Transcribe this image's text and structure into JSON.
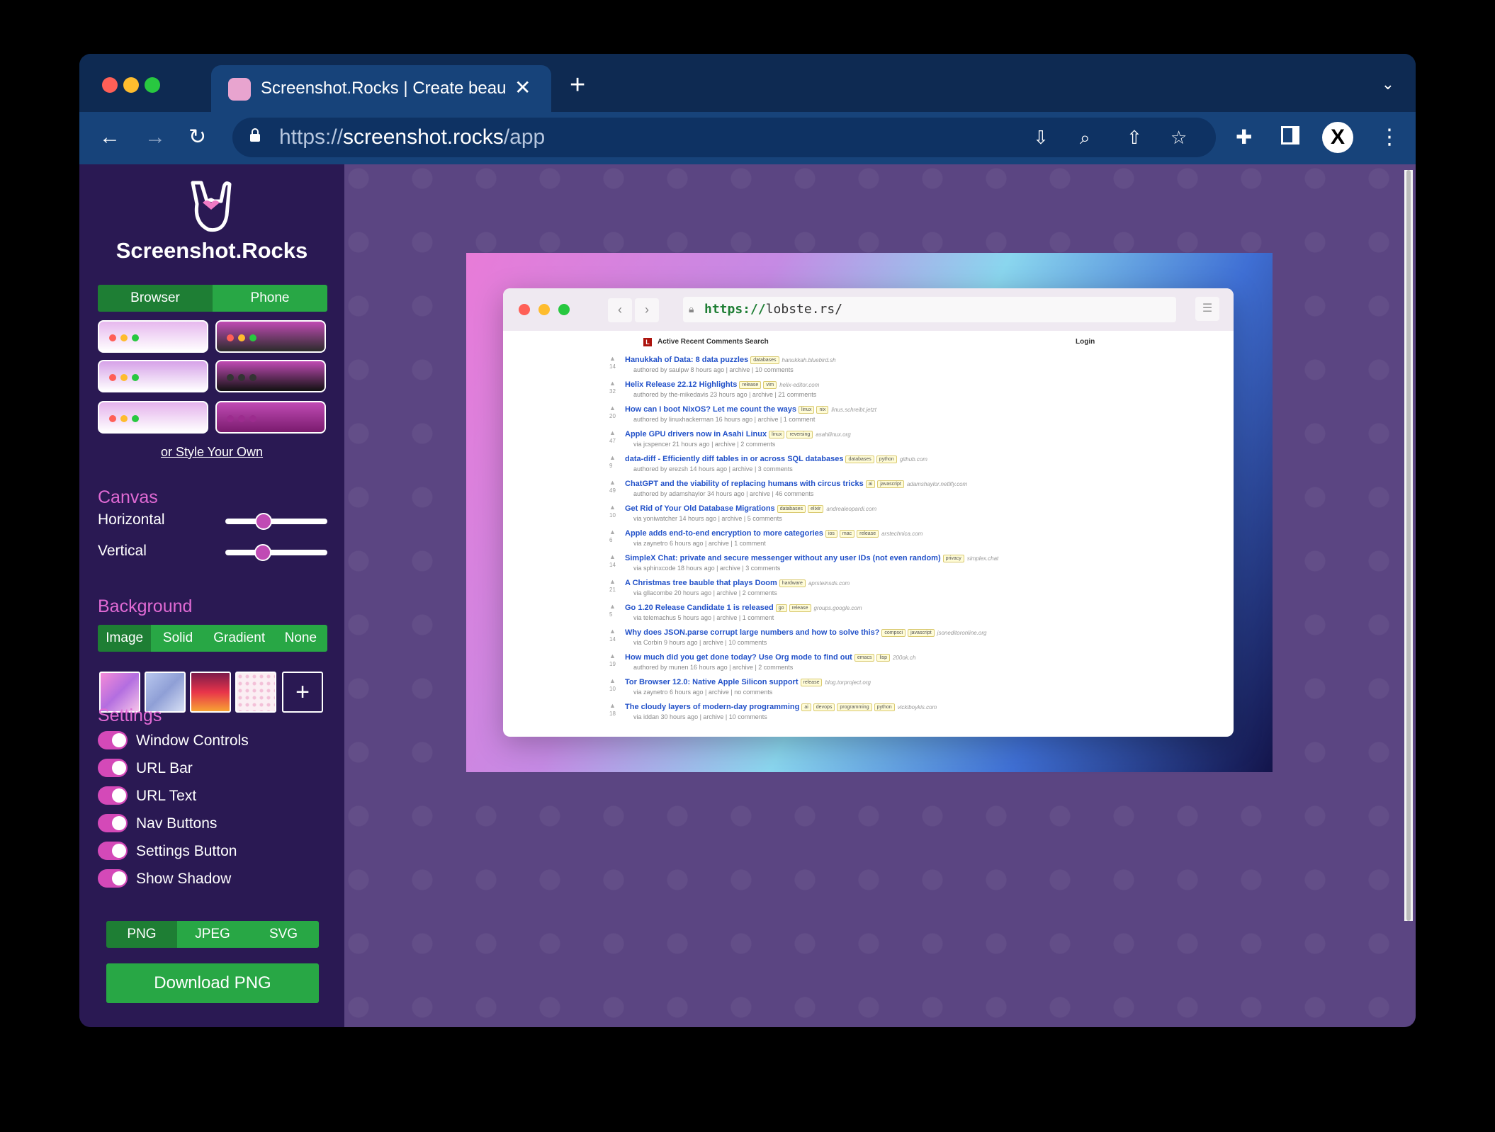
{
  "browser": {
    "tab_title": "Screenshot.Rocks | Create beau",
    "url_prefix": "https://",
    "url_host": "screenshot.rocks",
    "url_path": "/app",
    "profile_letter": "X"
  },
  "sidebar": {
    "brand": "Screenshot.Rocks",
    "mode_tabs": [
      "Browser",
      "Phone"
    ],
    "style_link": "or Style Your Own",
    "canvas_title": "Canvas",
    "horizontal_label": "Horizontal",
    "vertical_label": "Vertical",
    "horizontal_value": 0.35,
    "vertical_value": 0.34,
    "background_title": "Background",
    "background_tabs": [
      "Image",
      "Solid",
      "Gradient",
      "None"
    ],
    "settings_title": "Settings",
    "settings": [
      "Window Controls",
      "URL Bar",
      "URL Text",
      "Nav Buttons",
      "Settings Button",
      "Show Shadow"
    ],
    "format_tabs": [
      "PNG",
      "JPEG",
      "SVG"
    ],
    "download_label": "Download PNG"
  },
  "preview": {
    "url_prefix": "https://",
    "url_rest": "lobste.rs/",
    "nav": "Active  Recent  Comments  Search",
    "login": "Login",
    "stories": [
      {
        "score": "14",
        "title": "Hanukkah of Data: 8 data puzzles",
        "tags": [
          "databases"
        ],
        "domain": "hanukkah.bluebird.sh",
        "meta": "authored by saulpw 8 hours ago | archive | 10 comments"
      },
      {
        "score": "32",
        "title": "Helix Release 22.12 Highlights",
        "tags": [
          "release",
          "vim"
        ],
        "domain": "helix-editor.com",
        "meta": "authored by the-mikedavis 23 hours ago | archive | 21 comments"
      },
      {
        "score": "20",
        "title": "How can I boot NixOS? Let me count the ways",
        "tags": [
          "linux",
          "nix"
        ],
        "domain": "linus.schreibt.jetzt",
        "meta": "authored by linuxhackerman 16 hours ago | archive | 1 comment"
      },
      {
        "score": "47",
        "title": "Apple GPU drivers now in Asahi Linux",
        "tags": [
          "linux",
          "reversing"
        ],
        "domain": "asahilinux.org",
        "meta": "via jcspencer 21 hours ago | archive | 2 comments"
      },
      {
        "score": "9",
        "title": "data-diff - Efficiently diff tables in or across SQL databases",
        "tags": [
          "databases",
          "python"
        ],
        "domain": "github.com",
        "meta": "authored by erezsh 14 hours ago | archive | 3 comments"
      },
      {
        "score": "49",
        "title": "ChatGPT and the viability of replacing humans with circus tricks",
        "tags": [
          "ai",
          "javascript"
        ],
        "domain": "adamshaylor.netlify.com",
        "meta": "authored by adamshaylor 34 hours ago | archive | 46 comments"
      },
      {
        "score": "10",
        "title": "Get Rid of Your Old Database Migrations",
        "tags": [
          "databases",
          "elixir"
        ],
        "domain": "andrealeopardi.com",
        "meta": "via yoniwatcher 14 hours ago | archive | 5 comments"
      },
      {
        "score": "6",
        "title": "Apple adds end-to-end encryption to more categories",
        "tags": [
          "ios",
          "mac",
          "release"
        ],
        "domain": "arstechnica.com",
        "meta": "via zaynetro 6 hours ago | archive | 1 comment"
      },
      {
        "score": "14",
        "title": "SimpleX Chat: private and secure messenger without any user IDs (not even random)",
        "tags": [
          "privacy"
        ],
        "domain": "simplex.chat",
        "meta": "via sphinxcode 18 hours ago | archive | 3 comments"
      },
      {
        "score": "21",
        "title": "A Christmas tree bauble that plays Doom",
        "tags": [
          "hardware"
        ],
        "domain": "aprsteinsds.com",
        "meta": "via gllacombe 20 hours ago | archive | 2 comments"
      },
      {
        "score": "5",
        "title": "Go 1.20 Release Candidate 1 is released",
        "tags": [
          "go",
          "release"
        ],
        "domain": "groups.google.com",
        "meta": "via telemachus 5 hours ago | archive | 1 comment"
      },
      {
        "score": "14",
        "title": "Why does JSON.parse corrupt large numbers and how to solve this?",
        "tags": [
          "compsci",
          "javascript"
        ],
        "domain": "jsoneditoronline.org",
        "meta": "via Corbin 9 hours ago | archive | 10 comments"
      },
      {
        "score": "19",
        "title": "How much did you get done today? Use Org mode to find out",
        "tags": [
          "emacs",
          "lisp"
        ],
        "domain": "200ok.ch",
        "meta": "authored by munen 16 hours ago | archive | 2 comments"
      },
      {
        "score": "10",
        "title": "Tor Browser 12.0: Native Apple Silicon support",
        "tags": [
          "release"
        ],
        "domain": "blog.torproject.org",
        "meta": "via zaynetro 6 hours ago | archive | no comments"
      },
      {
        "score": "18",
        "title": "The cloudy layers of modern-day programming",
        "tags": [
          "ai",
          "devops",
          "programming",
          "python"
        ],
        "domain": "vickiboykis.com",
        "meta": "via iddan 30 hours ago | archive | 10 comments"
      }
    ]
  },
  "colors": {
    "accent_pink": "#e06ad4",
    "toggle": "#d449b8",
    "green": "#28a745",
    "sidebar_bg": "#2a1953",
    "main_bg": "#5b4582"
  }
}
